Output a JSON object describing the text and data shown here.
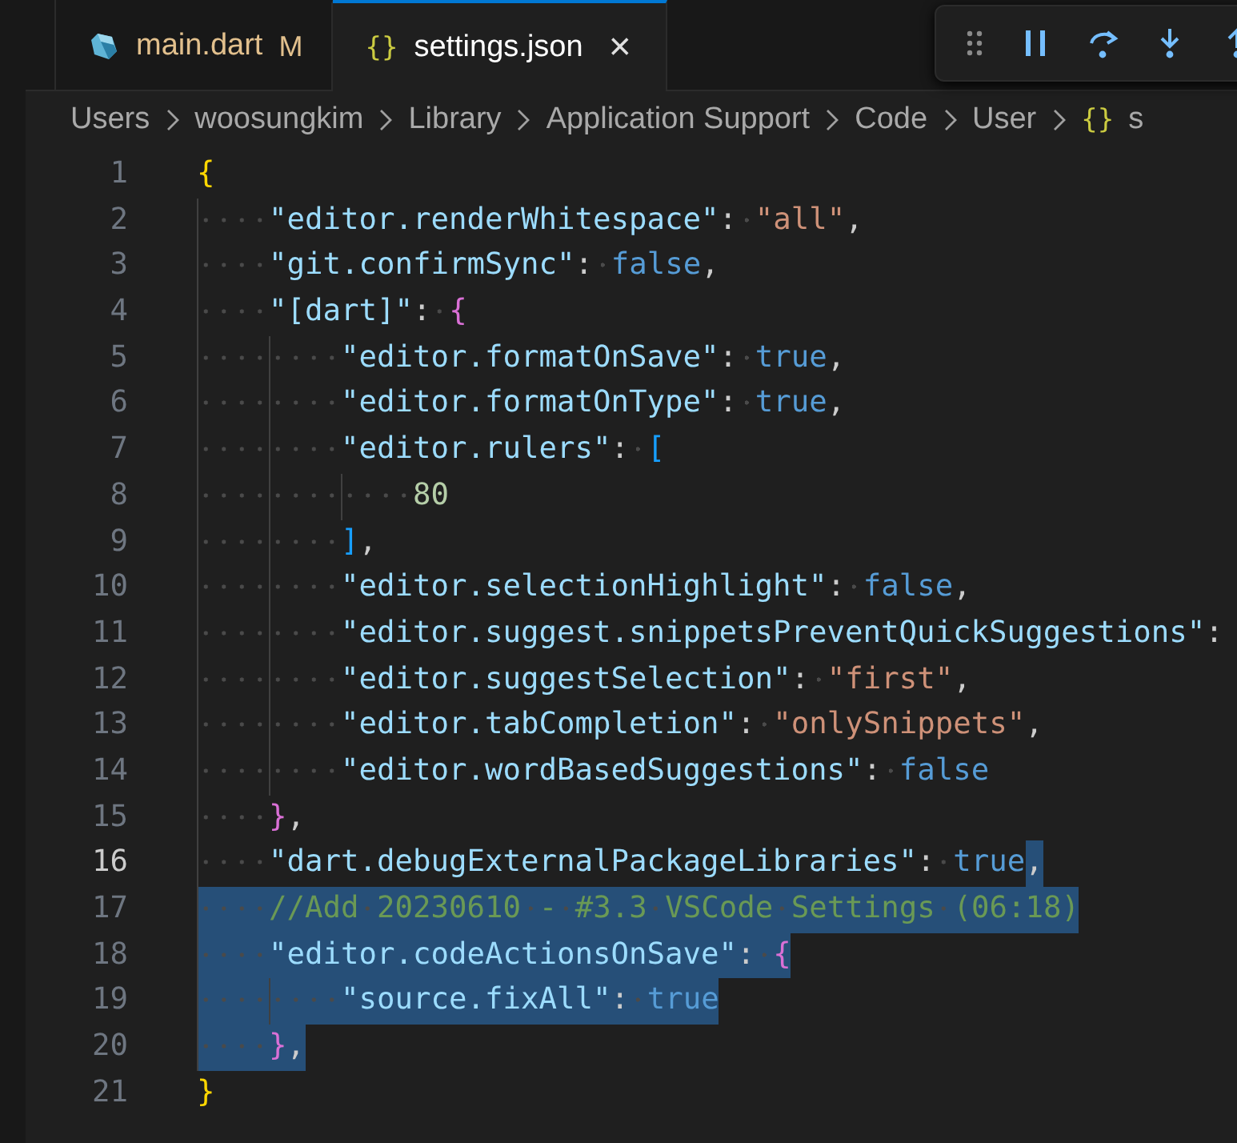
{
  "tabs": [
    {
      "label": "main.dart",
      "badge": "M",
      "kind": "dart",
      "selected": false
    },
    {
      "label": "settings.json",
      "icon": "{}",
      "close": "×",
      "kind": "json",
      "selected": true
    }
  ],
  "debug_toolbar": {
    "kind": "debug"
  },
  "breadcrumb": [
    {
      "text": "Users"
    },
    {
      "text": "woosungkim"
    },
    {
      "text": "Library"
    },
    {
      "text": "Application Support"
    },
    {
      "text": "Code"
    },
    {
      "text": "User"
    },
    {
      "text": "s",
      "icon": "{}"
    }
  ],
  "editor": {
    "lines": [
      {
        "number": "1",
        "current": false,
        "tokens": [
          {
            "kind": "b1",
            "text": "{",
            "selected": false
          }
        ]
      },
      {
        "number": "2",
        "current": false,
        "tokens": [
          {
            "kind": "key",
            "text": "    \"editor.renderWhitespace\"",
            "selected": false
          },
          {
            "kind": "punct",
            "text": ": ",
            "selected": false
          },
          {
            "kind": "str",
            "text": "\"all\"",
            "selected": false
          },
          {
            "kind": "punct",
            "text": ",",
            "selected": false
          }
        ]
      },
      {
        "number": "3",
        "current": false,
        "tokens": [
          {
            "kind": "key",
            "text": "    \"git.confirmSync\"",
            "selected": false
          },
          {
            "kind": "punct",
            "text": ": ",
            "selected": false
          },
          {
            "kind": "bool",
            "text": "false",
            "selected": false
          },
          {
            "kind": "punct",
            "text": ",",
            "selected": false
          }
        ]
      },
      {
        "number": "4",
        "current": false,
        "tokens": [
          {
            "kind": "key",
            "text": "    \"[dart]\"",
            "selected": false
          },
          {
            "kind": "punct",
            "text": ": ",
            "selected": false
          },
          {
            "kind": "b2",
            "text": "{",
            "selected": false
          }
        ]
      },
      {
        "number": "5",
        "current": false,
        "tokens": [
          {
            "kind": "key",
            "text": "        \"editor.formatOnSave\"",
            "selected": false
          },
          {
            "kind": "punct",
            "text": ": ",
            "selected": false
          },
          {
            "kind": "bool",
            "text": "true",
            "selected": false
          },
          {
            "kind": "punct",
            "text": ",",
            "selected": false
          }
        ]
      },
      {
        "number": "6",
        "current": false,
        "tokens": [
          {
            "kind": "key",
            "text": "        \"editor.formatOnType\"",
            "selected": false
          },
          {
            "kind": "punct",
            "text": ": ",
            "selected": false
          },
          {
            "kind": "bool",
            "text": "true",
            "selected": false
          },
          {
            "kind": "punct",
            "text": ",",
            "selected": false
          }
        ]
      },
      {
        "number": "7",
        "current": false,
        "tokens": [
          {
            "kind": "key",
            "text": "        \"editor.rulers\"",
            "selected": false
          },
          {
            "kind": "punct",
            "text": ": ",
            "selected": false
          },
          {
            "kind": "b3",
            "text": "[",
            "selected": false
          }
        ]
      },
      {
        "number": "8",
        "current": false,
        "tokens": [
          {
            "kind": "num",
            "text": "            80",
            "selected": false
          }
        ]
      },
      {
        "number": "9",
        "current": false,
        "tokens": [
          {
            "kind": "b3",
            "text": "        ]",
            "selected": false
          },
          {
            "kind": "punct",
            "text": ",",
            "selected": false
          }
        ]
      },
      {
        "number": "10",
        "current": false,
        "tokens": [
          {
            "kind": "key",
            "text": "        \"editor.selectionHighlight\"",
            "selected": false
          },
          {
            "kind": "punct",
            "text": ": ",
            "selected": false
          },
          {
            "kind": "bool",
            "text": "false",
            "selected": false
          },
          {
            "kind": "punct",
            "text": ",",
            "selected": false
          }
        ]
      },
      {
        "number": "11",
        "current": false,
        "tokens": [
          {
            "kind": "key",
            "text": "        \"editor.suggest.snippetsPreventQuickSuggestions\"",
            "selected": false
          },
          {
            "kind": "punct",
            "text": ":",
            "selected": false
          }
        ]
      },
      {
        "number": "12",
        "current": false,
        "tokens": [
          {
            "kind": "key",
            "text": "        \"editor.suggestSelection\"",
            "selected": false
          },
          {
            "kind": "punct",
            "text": ": ",
            "selected": false
          },
          {
            "kind": "str",
            "text": "\"first\"",
            "selected": false
          },
          {
            "kind": "punct",
            "text": ",",
            "selected": false
          }
        ]
      },
      {
        "number": "13",
        "current": false,
        "tokens": [
          {
            "kind": "key",
            "text": "        \"editor.tabCompletion\"",
            "selected": false
          },
          {
            "kind": "punct",
            "text": ": ",
            "selected": false
          },
          {
            "kind": "str",
            "text": "\"onlySnippets\"",
            "selected": false
          },
          {
            "kind": "punct",
            "text": ",",
            "selected": false
          }
        ]
      },
      {
        "number": "14",
        "current": false,
        "tokens": [
          {
            "kind": "key",
            "text": "        \"editor.wordBasedSuggestions\"",
            "selected": false
          },
          {
            "kind": "punct",
            "text": ": ",
            "selected": false
          },
          {
            "kind": "bool",
            "text": "false",
            "selected": false
          }
        ]
      },
      {
        "number": "15",
        "current": false,
        "tokens": [
          {
            "kind": "b2",
            "text": "    }",
            "selected": false
          },
          {
            "kind": "punct",
            "text": ",",
            "selected": false
          }
        ]
      },
      {
        "number": "16",
        "current": true,
        "tokens": [
          {
            "kind": "key",
            "text": "    \"dart.debugExternalPackageLibraries\"",
            "selected": false
          },
          {
            "kind": "punct",
            "text": ": ",
            "selected": false
          },
          {
            "kind": "bool",
            "text": "true",
            "selected": false
          },
          {
            "kind": "punct",
            "text": ",",
            "selected": true
          }
        ]
      },
      {
        "number": "17",
        "current": false,
        "tokens": [
          {
            "kind": "comment",
            "text": "    //Add 20230610 - #3.3 VSCode Settings (06:18)",
            "selected": true
          }
        ]
      },
      {
        "number": "18",
        "current": false,
        "tokens": [
          {
            "kind": "key",
            "text": "    \"editor.codeActionsOnSave\"",
            "selected": true
          },
          {
            "kind": "punct",
            "text": ": ",
            "selected": true
          },
          {
            "kind": "b2",
            "text": "{",
            "selected": true
          }
        ]
      },
      {
        "number": "19",
        "current": false,
        "tokens": [
          {
            "kind": "key",
            "text": "        \"source.fixAll\"",
            "selected": true
          },
          {
            "kind": "punct",
            "text": ": ",
            "selected": true
          },
          {
            "kind": "bool",
            "text": "true",
            "selected": true
          }
        ]
      },
      {
        "number": "20",
        "current": false,
        "tokens": [
          {
            "kind": "b2",
            "text": "    }",
            "selected": true
          },
          {
            "kind": "punct",
            "text": ",",
            "selected": true
          }
        ]
      },
      {
        "number": "21",
        "current": false,
        "tokens": [
          {
            "kind": "b1",
            "text": "}",
            "selected": false
          }
        ]
      }
    ]
  }
}
